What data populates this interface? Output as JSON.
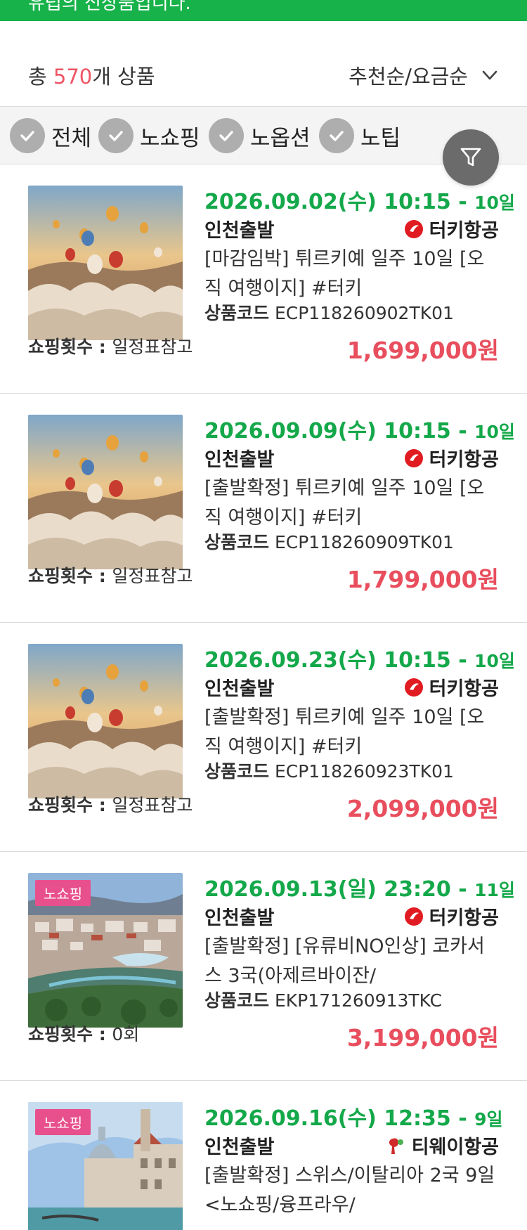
{
  "banner": {
    "text": "유럽의 신상품입니다."
  },
  "summary": {
    "total_prefix": "총 ",
    "total_count": "570",
    "total_suffix": "개 상품",
    "sort_label": "추천순/요금순"
  },
  "filters": [
    {
      "label": "전체"
    },
    {
      "label": "노쇼핑"
    },
    {
      "label": "노옵션"
    },
    {
      "label": "노팁"
    }
  ],
  "products": [
    {
      "date": "2026.09.02(수) 10:15 - ",
      "duration": "10일",
      "departure": "인천출발",
      "airline": "터키항공",
      "airline_icon": "turkish-airlines-icon",
      "title": "[마감임박] 튀르키예 일주 10일 [오직 여행이지] #터키",
      "code_label": "상품코드",
      "code": "ECP118260902TK01",
      "shopping_label": "쇼핑횟수 : ",
      "shopping": "일정표참고",
      "price": "1,699,000원",
      "badge": "",
      "image": "balloons"
    },
    {
      "date": "2026.09.09(수) 10:15 - ",
      "duration": "10일",
      "departure": "인천출발",
      "airline": "터키항공",
      "airline_icon": "turkish-airlines-icon",
      "title": "[출발확정] 튀르키예 일주 10일 [오직 여행이지] #터키",
      "code_label": "상품코드",
      "code": "ECP118260909TK01",
      "shopping_label": "쇼핑횟수 : ",
      "shopping": "일정표참고",
      "price": "1,799,000원",
      "badge": "",
      "image": "balloons"
    },
    {
      "date": "2026.09.23(수) 10:15 - ",
      "duration": "10일",
      "departure": "인천출발",
      "airline": "터키항공",
      "airline_icon": "turkish-airlines-icon",
      "title": "[출발확정] 튀르키예 일주 10일 [오직 여행이지] #터키",
      "code_label": "상품코드",
      "code": "ECP118260923TK01",
      "shopping_label": "쇼핑횟수 : ",
      "shopping": "일정표참고",
      "price": "2,099,000원",
      "badge": "",
      "image": "balloons"
    },
    {
      "date": "2026.09.13(일) 23:20 - ",
      "duration": "11일",
      "departure": "인천출발",
      "airline": "터키항공",
      "airline_icon": "turkish-airlines-icon",
      "title": "[출발확정] [유류비NO인상] 코카서스 3국(아제르바이잔/",
      "code_label": "상품코드",
      "code": "EKP171260913TKC",
      "shopping_label": "쇼핑횟수 : ",
      "shopping": "0회",
      "price": "3,199,000원",
      "badge": "노쇼핑",
      "image": "city"
    },
    {
      "date": "2026.09.16(수) 12:35 - ",
      "duration": "9일",
      "departure": "인천출발",
      "airline": "티웨이항공",
      "airline_icon": "tway-icon",
      "title": "[출발확정] 스위스/이탈리아 2국 9일 <노쇼핑/융프라우/",
      "code_label": "",
      "code": "",
      "shopping_label": "",
      "shopping": "",
      "price": "",
      "badge": "노쇼핑",
      "image": "venice"
    }
  ]
}
